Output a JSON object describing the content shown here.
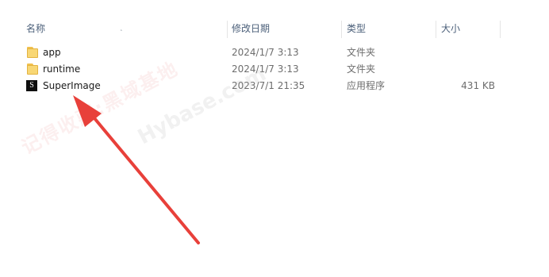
{
  "columns": {
    "name": "名称",
    "date": "修改日期",
    "type": "类型",
    "size": "大小"
  },
  "files": [
    {
      "icon": "folder-icon",
      "name": "app",
      "date": "2024/1/7 3:13",
      "type": "文件夹",
      "size": ""
    },
    {
      "icon": "folder-icon",
      "name": "runtime",
      "date": "2024/1/7 3:13",
      "type": "文件夹",
      "size": ""
    },
    {
      "icon": "superimage-app-icon",
      "icon_glyph": "S",
      "name": "SuperImage",
      "date": "2023/7/1 21:35",
      "type": "应用程序",
      "size": "431 KB"
    }
  ],
  "watermark": {
    "cn": "记得收藏:黑域基地",
    "en": "Hybase.com"
  },
  "colors": {
    "arrow": "#e8403a",
    "folder": "#f8d775",
    "header_text": "#4c607a"
  }
}
